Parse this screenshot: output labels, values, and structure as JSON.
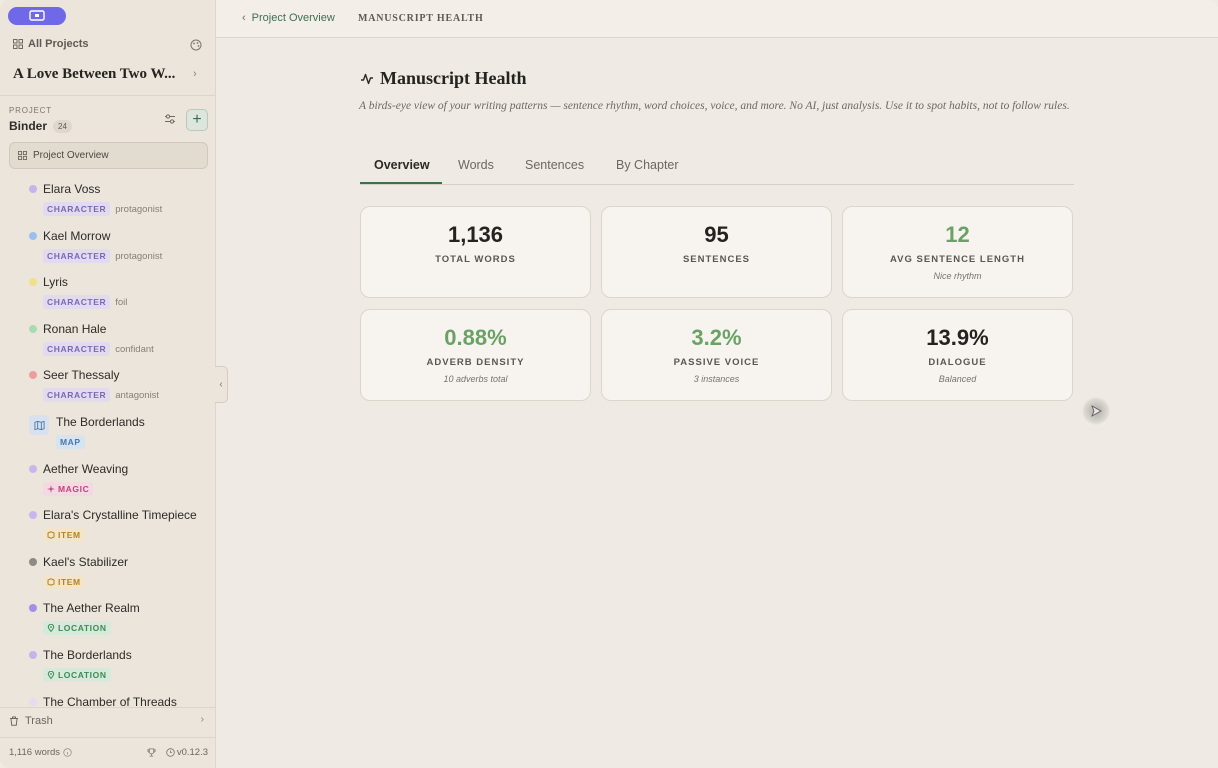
{
  "sidebar": {
    "all_projects": "All Projects",
    "project_title": "A Love Between Two W...",
    "section_label": "PROJECT",
    "binder_label": "Binder",
    "binder_count": "24",
    "overview_button": "Project Overview",
    "items": [
      {
        "name": "Elara Voss",
        "tag": "CHARACTER",
        "sub": "protagonist",
        "color": "#c3b4ec"
      },
      {
        "name": "Kael Morrow",
        "tag": "CHARACTER",
        "sub": "protagonist",
        "color": "#9cc0ee"
      },
      {
        "name": "Lyris",
        "tag": "CHARACTER",
        "sub": "foil",
        "color": "#f1e08a"
      },
      {
        "name": "Ronan Hale",
        "tag": "CHARACTER",
        "sub": "confidant",
        "color": "#a8dcb0"
      },
      {
        "name": "Seer Thessaly",
        "tag": "CHARACTER",
        "sub": "antagonist",
        "color": "#ef9c9c"
      },
      {
        "name": "The Borderlands",
        "tag": "MAP",
        "sub": "",
        "color": "#4a79a8"
      },
      {
        "name": "Aether Weaving",
        "tag": "MAGIC",
        "sub": "",
        "color": "#c9b6ef"
      },
      {
        "name": "Elara's Crystalline Timepiece",
        "tag": "ITEM",
        "sub": "",
        "color": "#c9b6ef"
      },
      {
        "name": "Kael's Stabilizer",
        "tag": "ITEM",
        "sub": "",
        "color": "#8e8b87"
      },
      {
        "name": "The Aether Realm",
        "tag": "LOCATION",
        "sub": "",
        "color": "#a38ee8"
      },
      {
        "name": "The Borderlands",
        "tag": "LOCATION",
        "sub": "",
        "color": "#c3b4ec"
      },
      {
        "name": "The Chamber of Threads",
        "tag": "",
        "sub": "",
        "color": "#e4dcf3"
      }
    ],
    "trash_label": "Trash",
    "footer_words": "1,116 words",
    "version": "v0.12.3"
  },
  "header": {
    "back_label": "Project Overview",
    "current": "MANUSCRIPT HEALTH"
  },
  "main": {
    "title": "Manuscript Health",
    "subtitle": "A birds-eye view of your writing patterns — sentence rhythm, word choices, voice, and more. No AI, just analysis. Use it to spot habits, not to follow rules.",
    "tabs": [
      "Overview",
      "Words",
      "Sentences",
      "By Chapter"
    ],
    "active_tab": "Overview",
    "cards": [
      {
        "value": "1,136",
        "label": "TOTAL WORDS",
        "note": ""
      },
      {
        "value": "95",
        "label": "SENTENCES",
        "note": ""
      },
      {
        "value": "12",
        "label": "AVG SENTENCE LENGTH",
        "note": "Nice rhythm"
      },
      {
        "value": "0.88%",
        "label": "ADVERB DENSITY",
        "note": "10 adverbs total"
      },
      {
        "value": "3.2%",
        "label": "PASSIVE VOICE",
        "note": "3 instances"
      },
      {
        "value": "13.9%",
        "label": "DIALOGUE",
        "note": "Balanced"
      }
    ]
  },
  "colors": {
    "accent_green": "#3f6e51",
    "stat_green": "#6aa266",
    "app_purple": "#6f68e8"
  }
}
